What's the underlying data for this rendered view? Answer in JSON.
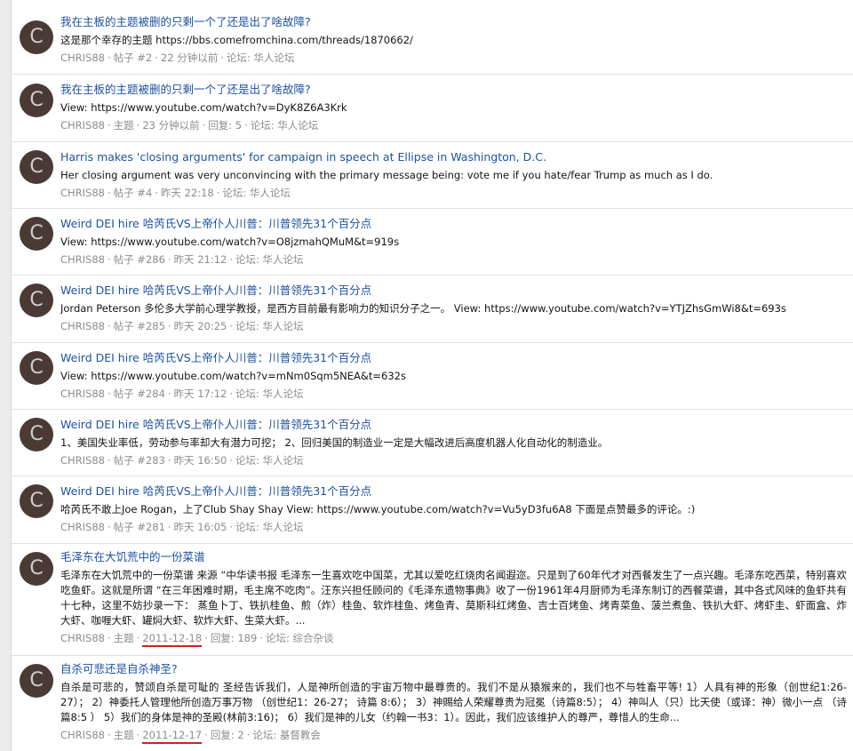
{
  "results": [
    {
      "avatar_letter": "C",
      "title": "我在主板的主题被删的只剩一个了还是出了啥故障?",
      "snippet": "这是那个幸存的主题 https://bbs.comefromchina.com/threads/1870662/",
      "author": "CHRIS88",
      "kind": "帖子 #2",
      "time": "22 分钟以前",
      "replies": "",
      "forum": "论坛: 华人论坛"
    },
    {
      "avatar_letter": "C",
      "title": "我在主板的主题被删的只剩一个了还是出了啥故障?",
      "snippet": "View: https://www.youtube.com/watch?v=DyK8Z6A3Krk",
      "author": "CHRIS88",
      "kind": "主题",
      "time": "23 分钟以前",
      "replies": "回复: 5",
      "forum": "论坛: 华人论坛"
    },
    {
      "avatar_letter": "C",
      "title": "Harris makes 'closing arguments' for campaign in speech at Ellipse in Washington, D.C.",
      "snippet": "Her closing argument was very unconvincing with the primary message being: vote me if you hate/fear Trump as much as I do.",
      "author": "CHRIS88",
      "kind": "帖子 #4",
      "time": "昨天 22:18",
      "replies": "",
      "forum": "论坛: 华人论坛"
    },
    {
      "avatar_letter": "C",
      "title": "Weird DEI hire 哈芮氏VS上帝仆人川普：川普领先31个百分点",
      "snippet": "View: https://www.youtube.com/watch?v=O8jzmahQMuM&t=919s",
      "author": "CHRIS88",
      "kind": "帖子 #286",
      "time": "昨天 21:12",
      "replies": "",
      "forum": "论坛: 华人论坛"
    },
    {
      "avatar_letter": "C",
      "title": "Weird DEI hire 哈芮氏VS上帝仆人川普：川普领先31个百分点",
      "snippet": "Jordan Peterson 多伦多大学前心理学教授，是西方目前最有影响力的知识分子之一。 View: https://www.youtube.com/watch?v=YTJZhsGmWi8&t=693s",
      "author": "CHRIS88",
      "kind": "帖子 #285",
      "time": "昨天 20:25",
      "replies": "",
      "forum": "论坛: 华人论坛"
    },
    {
      "avatar_letter": "C",
      "title": "Weird DEI hire 哈芮氏VS上帝仆人川普：川普领先31个百分点",
      "snippet": "View: https://www.youtube.com/watch?v=mNm0Sqm5NEA&t=632s",
      "author": "CHRIS88",
      "kind": "帖子 #284",
      "time": "昨天 17:12",
      "replies": "",
      "forum": "论坛: 华人论坛"
    },
    {
      "avatar_letter": "C",
      "title": "Weird DEI hire 哈芮氏VS上帝仆人川普：川普领先31个百分点",
      "snippet": "1、美国失业率低，劳动参与率却大有潜力可挖； 2、回归美国的制造业一定是大幅改进后高度机器人化自动化的制造业。",
      "author": "CHRIS88",
      "kind": "帖子 #283",
      "time": "昨天 16:50",
      "replies": "",
      "forum": "论坛: 华人论坛"
    },
    {
      "avatar_letter": "C",
      "title": "Weird DEI hire 哈芮氏VS上帝仆人川普：川普领先31个百分点",
      "snippet": "哈芮氏不敢上Joe Rogan，上了Club Shay Shay View: https://www.youtube.com/watch?v=Vu5yD3fu6A8 下面是点赞最多的评论。:)",
      "author": "CHRIS88",
      "kind": "帖子 #281",
      "time": "昨天 16:05",
      "replies": "",
      "forum": "论坛: 华人论坛"
    },
    {
      "avatar_letter": "C",
      "title": "毛泽东在大饥荒中的一份菜谱",
      "snippet": "毛泽东在大饥荒中的一份菜谱 来源 “中华读书报 毛泽东一生喜欢吃中国菜，尤其以爱吃红烧肉名闻遐迩。只是到了60年代才对西餐发生了一点兴趣。毛泽东吃西菜，特别喜欢吃鱼虾。这就是所谓 “在三年困难时期，毛主席不吃肉”。汪东兴担任顾问的《毛泽东遗物事典》收了一份1961年4月厨师为毛泽东制订的西餐菜谱，其中各式风味的鱼虾共有十七种，这里不妨抄录一下： 蒸鱼卜丁、铁扒桂鱼、煎（炸）桂鱼、软炸桂鱼、烤鱼青、莫斯科红烤鱼、吉士百烤鱼、烤青菜鱼、菠兰煮鱼、铁扒大虾、烤虾圭、虾面盒、炸大虾、咖喱大虾、罐焖大虾、软炸大虾、生菜大虾。...",
      "author": "CHRIS88",
      "kind": "主题",
      "time": "2011-12-18",
      "replies": "回复: 189",
      "forum": "论坛: 综合杂谈"
    },
    {
      "avatar_letter": "C",
      "title": "自杀可悲还是自杀神圣?",
      "snippet": "自杀是可悲的，赞颂自杀是可耻的 圣经告诉我们，人是神所创造的宇宙万物中最尊贵的。我们不是从猿猴来的，我们也不与牲畜平等! 1）人具有神的形象（创世纪1:26-27）； 2）神委托人管理他所创造万事万物 （创世纪1：26-27； 诗篇 8:6）； 3）神赐给人荣耀尊贵为冠冕（诗篇8:5）； 4）神叫人（只）比天使（或译：神）微小一点 （诗篇8:5 ） 5）我们的身体是神的圣殿(林前3:16)； 6）我们是神的儿女（约翰一书3：1）。因此，我们应该维护人的尊严，尊惜人的生命...",
      "author": "CHRIS88",
      "kind": "主题",
      "time": "2011-12-17",
      "replies": "回复: 2",
      "forum": "论坛: 基督教会"
    }
  ]
}
